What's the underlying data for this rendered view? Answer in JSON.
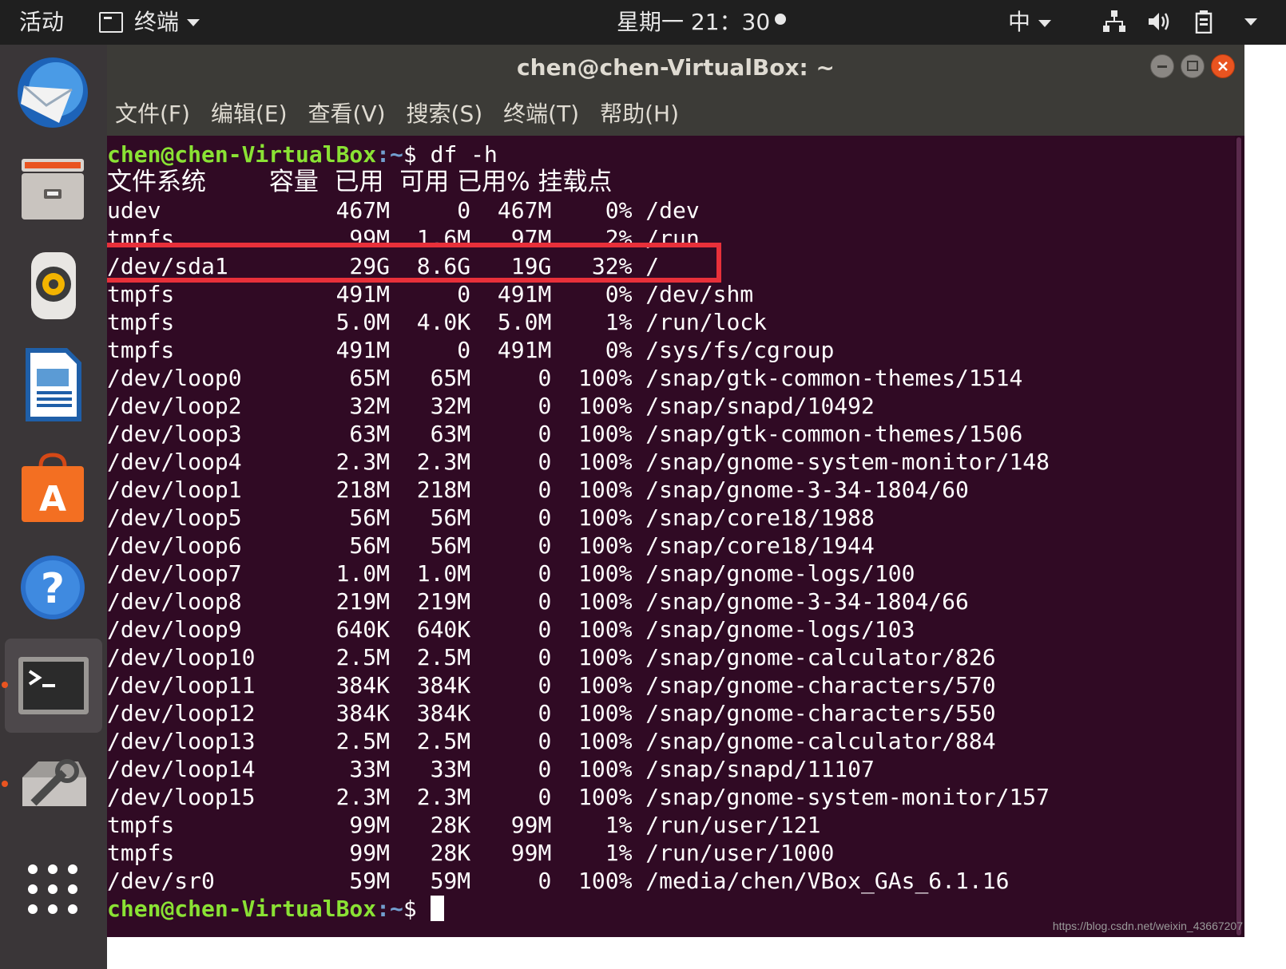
{
  "topbar": {
    "activities": "活动",
    "app_name": "终端",
    "clock": "星期一 21：30",
    "input_method": "中"
  },
  "window": {
    "title": "chen@chen-VirtualBox: ~"
  },
  "menu": [
    "文件(F)",
    "编辑(E)",
    "查看(V)",
    "搜索(S)",
    "终端(T)",
    "帮助(H)"
  ],
  "terminal": {
    "prompt_user": "chen@chen-VirtualBox",
    "prompt_path": ":~",
    "prompt_symbol": "$ ",
    "command": "df -h",
    "header": "文件系统        容量  已用  可用 已用% 挂载点",
    "rows": [
      "udev             467M     0  467M    0% /dev",
      "tmpfs             99M  1.6M   97M    2% /run",
      "/dev/sda1         29G  8.6G   19G   32% /",
      "tmpfs            491M     0  491M    0% /dev/shm",
      "tmpfs            5.0M  4.0K  5.0M    1% /run/lock",
      "tmpfs            491M     0  491M    0% /sys/fs/cgroup",
      "/dev/loop0        65M   65M     0  100% /snap/gtk-common-themes/1514",
      "/dev/loop2        32M   32M     0  100% /snap/snapd/10492",
      "/dev/loop3        63M   63M     0  100% /snap/gtk-common-themes/1506",
      "/dev/loop4       2.3M  2.3M     0  100% /snap/gnome-system-monitor/148",
      "/dev/loop1       218M  218M     0  100% /snap/gnome-3-34-1804/60",
      "/dev/loop5        56M   56M     0  100% /snap/core18/1988",
      "/dev/loop6        56M   56M     0  100% /snap/core18/1944",
      "/dev/loop7       1.0M  1.0M     0  100% /snap/gnome-logs/100",
      "/dev/loop8       219M  219M     0  100% /snap/gnome-3-34-1804/66",
      "/dev/loop9       640K  640K     0  100% /snap/gnome-logs/103",
      "/dev/loop10      2.5M  2.5M     0  100% /snap/gnome-calculator/826",
      "/dev/loop11      384K  384K     0  100% /snap/gnome-characters/570",
      "/dev/loop12      384K  384K     0  100% /snap/gnome-characters/550",
      "/dev/loop13      2.5M  2.5M     0  100% /snap/gnome-calculator/884",
      "/dev/loop14       33M   33M     0  100% /snap/snapd/11107",
      "/dev/loop15      2.3M  2.3M     0  100% /snap/gnome-system-monitor/157",
      "tmpfs             99M   28K   99M    1% /run/user/121",
      "tmpfs             99M   28K   99M    1% /run/user/1000",
      "/dev/sr0          59M   59M     0  100% /media/chen/VBox_GAs_6.1.16"
    ]
  },
  "dock": [
    "thunderbird-icon",
    "files-icon",
    "rhythmbox-icon",
    "writer-icon",
    "software-icon",
    "help-icon",
    "terminal-icon",
    "software-updater-icon",
    "show-apps-icon"
  ],
  "colors": {
    "terminal_bg": "#300a24",
    "prompt_user": "#8ae234",
    "prompt_path": "#729fcf",
    "highlight": "#e8303a",
    "accent": "#e95420"
  },
  "watermark": "https://blog.csdn.net/weixin_43667207"
}
